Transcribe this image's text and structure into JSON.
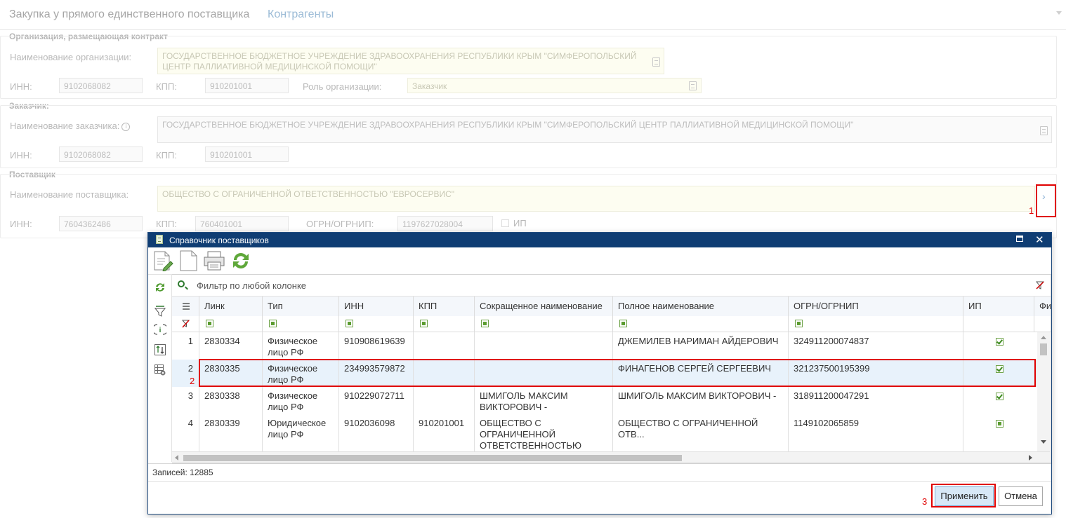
{
  "tabs": [
    {
      "label": "Закупка у прямого единственного поставщика",
      "active": false
    },
    {
      "label": "Контрагенты",
      "active": true
    }
  ],
  "organization": {
    "title": "Организация, размещающая контракт",
    "name_label": "Наименование организации:",
    "name_value": "ГОСУДАРСТВЕННОЕ БЮДЖЕТНОЕ УЧРЕЖДЕНИЕ ЗДРАВООХРАНЕНИЯ РЕСПУБЛИКИ КРЫМ \"СИМФЕРОПОЛЬСКИЙ ЦЕНТР ПАЛЛИАТИВНОЙ МЕДИЦИНСКОЙ ПОМОЩИ\"",
    "inn_label": "ИНН:",
    "inn_value": "9102068082",
    "kpp_label": "КПП:",
    "kpp_value": "910201001",
    "role_label": "Роль организации:",
    "role_value": "Заказчик"
  },
  "customer": {
    "title": "Заказчик:",
    "name_label": "Наименование заказчика:",
    "name_value": "ГОСУДАРСТВЕННОЕ БЮДЖЕТНОЕ УЧРЕЖДЕНИЕ ЗДРАВООХРАНЕНИЯ РЕСПУБЛИКИ КРЫМ \"СИМФЕРОПОЛЬСКИЙ ЦЕНТР ПАЛЛИАТИВНОЙ МЕДИЦИНСКОЙ ПОМОЩИ\"",
    "inn_label": "ИНН:",
    "inn_value": "9102068082",
    "kpp_label": "КПП:",
    "kpp_value": "910201001"
  },
  "supplier": {
    "title": "Поставщик",
    "name_label": "Наименование поставщика:",
    "name_value": "ОБЩЕСТВО С ОГРАНИЧЕННОЙ ОТВЕТСТВЕННОСТЬЮ \"ЕВРОСЕРВИС\"",
    "inn_label": "ИНН:",
    "inn_value": "7604362486",
    "kpp_label": "КПП:",
    "kpp_value": "760401001",
    "ogrn_label": "ОГРН/ОГРНИП:",
    "ogrn_value": "1197627028004",
    "ip_label": "ИП",
    "select_button_glyph": "›"
  },
  "annotations": {
    "n1": "1",
    "n2": "2",
    "n3": "3",
    "color": "#e00000"
  },
  "dialog": {
    "title": "Справочник поставщиков",
    "filter_placeholder": "Фильтр по любой колонке",
    "columns": [
      "Линк",
      "Тип",
      "ИНН",
      "КПП",
      "Сокращенное наименование",
      "Полное наименование",
      "ОГРН/ОГРНИП",
      "ИП",
      "Фи"
    ],
    "rows": [
      {
        "n": "1",
        "link": "2830334",
        "type": "Физическое лицо РФ",
        "inn": "910908619639",
        "kpp": "",
        "short": "",
        "full": "ДЖЕМИЛЕВ НАРИМАН АЙДЕРОВИЧ",
        "ogrn": "324911200074837",
        "ip": "checked"
      },
      {
        "n": "2",
        "link": "2830335",
        "type": "Физическое лицо РФ",
        "inn": "234993579872",
        "kpp": "",
        "short": "",
        "full": "ФИНАГЕНОВ СЕРГЕЙ СЕРГЕЕВИЧ",
        "ogrn": "321237500195399",
        "ip": "checked"
      },
      {
        "n": "3",
        "link": "2830338",
        "type": "Физическое лицо РФ",
        "inn": "910229072711",
        "kpp": "",
        "short": "ШМИГОЛЬ МАКСИМ ВИКТОРОВИЧ -",
        "full": "ШМИГОЛЬ МАКСИМ ВИКТОРОВИЧ -",
        "ogrn": "318911200047291",
        "ip": "checked"
      },
      {
        "n": "4",
        "link": "2830339",
        "type": "Юридическое лицо РФ",
        "inn": "9102036098",
        "kpp": "910201001",
        "short": "ОБЩЕСТВО С ОГРАНИЧЕННОЙ ОТВЕТСТВЕННОСТЬЮ",
        "full": "ОБЩЕСТВО С ОГРАНИЧЕННОЙ ОТВ...",
        "ogrn": "1149102065859",
        "ip": "indeterminate"
      }
    ],
    "selected_row": 2,
    "status": "Записей: 12885",
    "apply_label": "Применить",
    "cancel_label": "Отмена",
    "close_glyph": "✕"
  }
}
